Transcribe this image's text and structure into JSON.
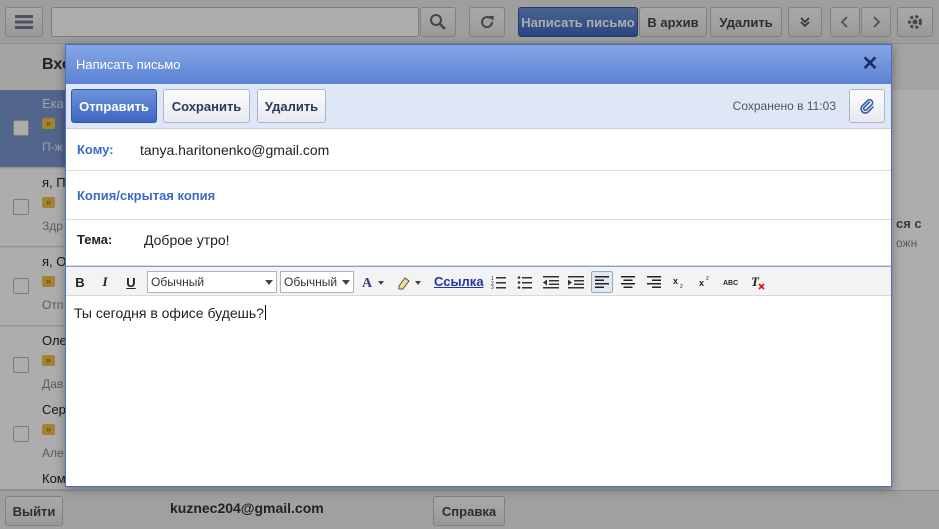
{
  "background": {
    "toolbar": {
      "compose_label": "Написать письмо",
      "archive_label": "В архив",
      "delete_label": "Удалить"
    },
    "inbox_title": "Вхо",
    "rows": [
      {
        "from": "Ека",
        "snippet": "П-ж"
      },
      {
        "from": "я, П",
        "snippet": "Здр"
      },
      {
        "from": "я, О",
        "snippet": "Отп"
      },
      {
        "from": "Оле",
        "snippet": "Дав"
      },
      {
        "from": "Сер",
        "snippet": "Але"
      },
      {
        "from": "Ком",
        "snippet": ""
      }
    ],
    "right_panel": {
      "line1": "ся с",
      "line2": "ожн"
    },
    "bottom": {
      "logout_label": "Выйти",
      "account_email": "kuznec204@gmail.com",
      "help_label": "Справка"
    }
  },
  "dialog": {
    "title": "Написать письмо",
    "toolbar": {
      "send_label": "Отправить",
      "save_label": "Сохранить",
      "delete_label": "Удалить",
      "saved_status": "Сохранено в 11:03"
    },
    "to": {
      "label": "Кому:",
      "value": "tanya.haritonenko@gmail.com"
    },
    "cc_label": "Копия/скрытая копия",
    "subject": {
      "label": "Тема:",
      "value": "Доброе утро!"
    },
    "editor": {
      "bold": "B",
      "italic": "I",
      "underline": "U",
      "font_select": "Обычный",
      "size_select": "Обычный",
      "link_label": "Ссылка",
      "body_text": "Ты сегодня в офисе будешь?"
    }
  }
}
